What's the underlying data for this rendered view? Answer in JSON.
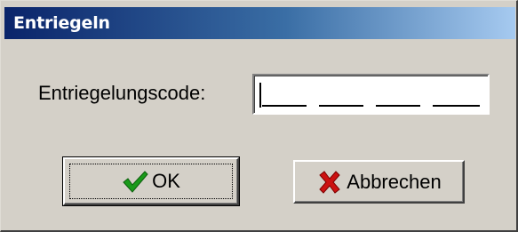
{
  "window": {
    "title": "Entriegeln"
  },
  "form": {
    "label": "Entriegelungscode:",
    "code_value": ""
  },
  "buttons": {
    "ok_label": "OK",
    "ok_icon": "checkmark-icon",
    "cancel_label": "Abbrechen",
    "cancel_icon": "cross-icon"
  },
  "colors": {
    "title_bar_start": "#0a246a",
    "title_bar_end": "#a6caf0",
    "dialog_face": "#d4d0c8",
    "check_green": "#1a9a1a",
    "cross_red": "#cc1111"
  }
}
